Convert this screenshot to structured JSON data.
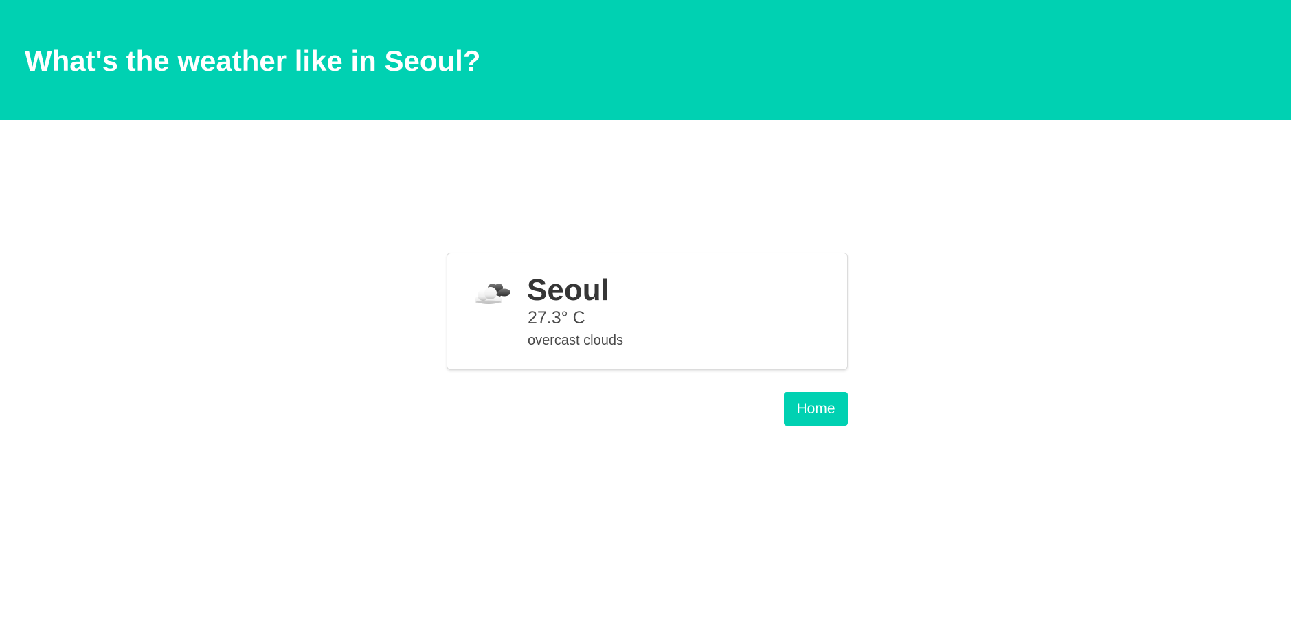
{
  "header": {
    "title": "What's the weather like in Seoul?"
  },
  "weather_card": {
    "icon": "overcast-clouds-icon",
    "city": "Seoul",
    "temperature": "27.3° C",
    "description": "overcast clouds"
  },
  "actions": {
    "home_label": "Home"
  },
  "colors": {
    "accent": "#00d1b2",
    "text_dark": "#363636",
    "text_body": "#4a4a4a",
    "background": "#ffffff"
  }
}
